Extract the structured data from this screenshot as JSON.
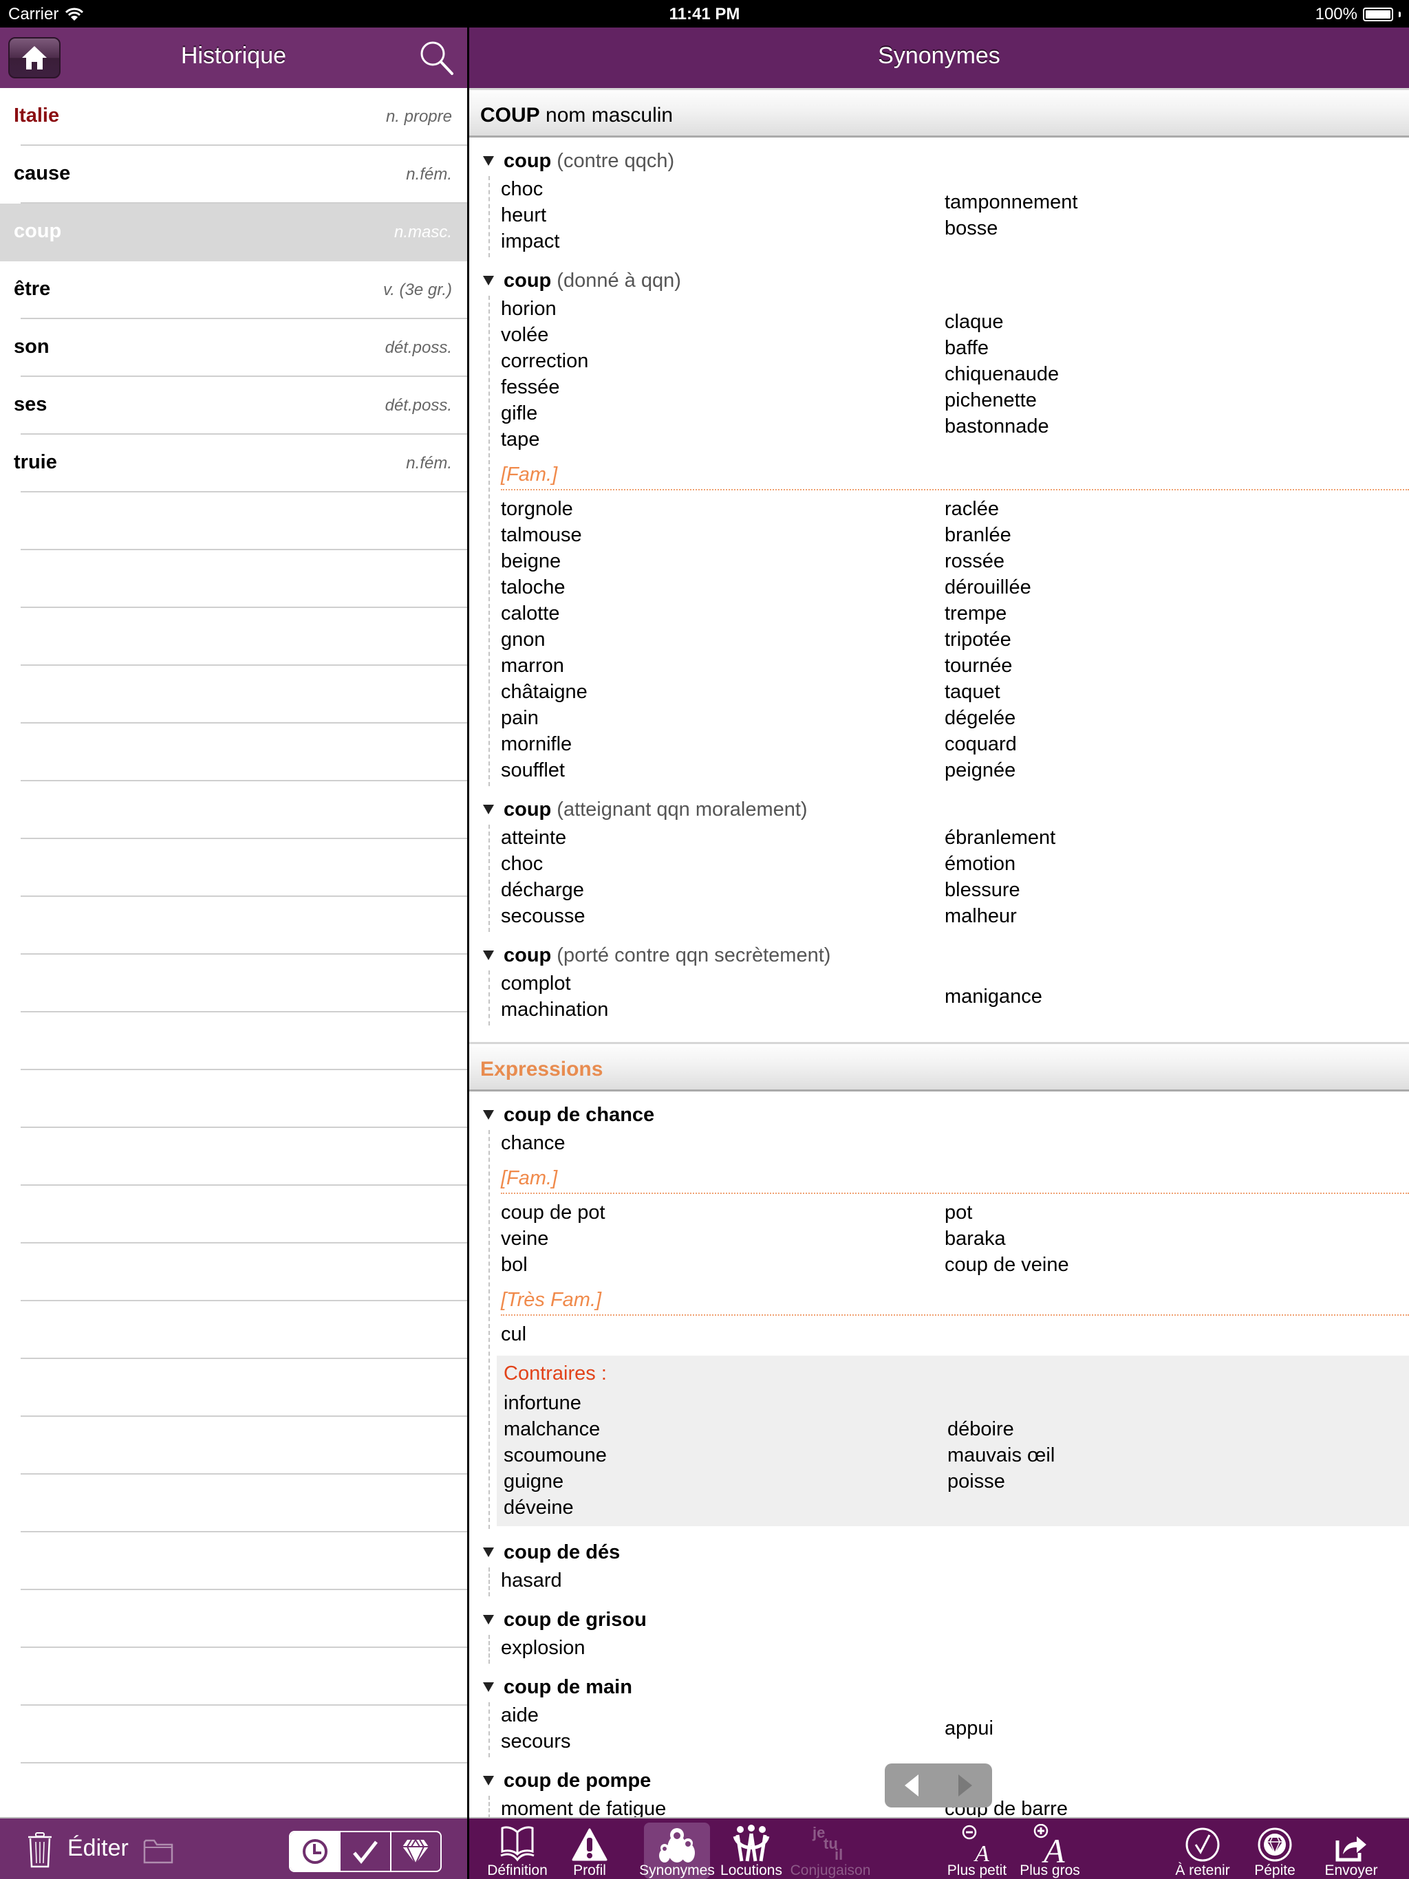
{
  "status_bar": {
    "carrier": "Carrier",
    "time": "11:41 PM",
    "battery": "100%"
  },
  "history": {
    "title": "Historique",
    "items": [
      {
        "word": "Italie",
        "category": "n. propre"
      },
      {
        "word": "cause",
        "category": "n.fém."
      },
      {
        "word": "coup",
        "category": "n.masc.",
        "selected": true
      },
      {
        "word": "être",
        "category": "v. (3e gr.)"
      },
      {
        "word": "son",
        "category": "dét.poss."
      },
      {
        "word": "ses",
        "category": "dét.poss."
      },
      {
        "word": "truie",
        "category": "n.fém."
      }
    ],
    "footer": {
      "edit_label": "Éditer"
    }
  },
  "synonyms": {
    "title": "Synonymes",
    "headword": "COUP",
    "headword_pos": "nom masculin",
    "senses": [
      {
        "word": "coup",
        "qualifier": "(contre qqch)",
        "groups": [
          {
            "left": [
              "choc",
              "heurt",
              "impact"
            ],
            "right": [
              "tamponnement",
              "bosse"
            ]
          }
        ]
      },
      {
        "word": "coup",
        "qualifier": "(donné à qqn)",
        "groups": [
          {
            "left": [
              "horion",
              "volée",
              "correction",
              "fessée",
              "gifle",
              "tape"
            ],
            "right": [
              "claque",
              "baffe",
              "chiquenaude",
              "pichenette",
              "bastonnade"
            ]
          },
          {
            "register": "[Fam.]",
            "left": [
              "torgnole",
              "talmouse",
              "beigne",
              "taloche",
              "calotte",
              "gnon",
              "marron",
              "châtaigne",
              "pain",
              "mornifle",
              "soufflet"
            ],
            "right": [
              "raclée",
              "branlée",
              "rossée",
              "dérouillée",
              "trempe",
              "tripotée",
              "tournée",
              "taquet",
              "dégelée",
              "coquard",
              "peignée"
            ]
          }
        ]
      },
      {
        "word": "coup",
        "qualifier": "(atteignant qqn moralement)",
        "groups": [
          {
            "left": [
              "atteinte",
              "choc",
              "décharge",
              "secousse"
            ],
            "right": [
              "ébranlement",
              "émotion",
              "blessure",
              "malheur"
            ]
          }
        ]
      },
      {
        "word": "coup",
        "qualifier": "(porté contre qqn secrètement)",
        "groups": [
          {
            "left": [
              "complot",
              "machination"
            ],
            "right": [
              "manigance"
            ]
          }
        ]
      }
    ],
    "expressions_label": "Expressions",
    "expressions": [
      {
        "word": "coup de chance",
        "groups": [
          {
            "left": [
              "chance"
            ],
            "right": []
          },
          {
            "register": "[Fam.]",
            "left": [
              "coup de pot",
              "veine",
              "bol"
            ],
            "right": [
              "pot",
              "baraka",
              "coup de veine"
            ]
          },
          {
            "register": "[Très Fam.]",
            "left": [
              "cul"
            ],
            "right": []
          }
        ],
        "contraires": {
          "label": "Contraires :",
          "left": [
            "infortune",
            "malchance",
            "scoumoune",
            "guigne",
            "déveine"
          ],
          "right": [
            "déboire",
            "mauvais œil",
            "poisse"
          ]
        }
      },
      {
        "word": "coup de dés",
        "groups": [
          {
            "left": [
              "hasard"
            ],
            "right": []
          }
        ]
      },
      {
        "word": "coup de grisou",
        "groups": [
          {
            "left": [
              "explosion"
            ],
            "right": []
          }
        ]
      },
      {
        "word": "coup de main",
        "groups": [
          {
            "left": [
              "aide",
              "secours"
            ],
            "right": [
              "appui"
            ]
          }
        ]
      },
      {
        "word": "coup de pompe",
        "groups": [
          {
            "left": [
              "moment de fatigue"
            ],
            "right": [
              "coup de barre"
            ]
          }
        ]
      }
    ]
  },
  "toolbar": {
    "items": [
      {
        "label": "Définition",
        "icon": "book-icon"
      },
      {
        "label": "Profil",
        "icon": "warning-icon"
      },
      {
        "label": "Synonymes",
        "icon": "dolls-icon",
        "active": true
      },
      {
        "label": "Locutions",
        "icon": "people-icon"
      },
      {
        "label": "Conjugaison",
        "icon": "je-tu-il-icon",
        "disabled": true
      },
      {
        "label": "Plus petit",
        "icon": "font-smaller-icon"
      },
      {
        "label": "Plus gros",
        "icon": "font-larger-icon"
      },
      {
        "label": "À retenir",
        "icon": "check-circle-icon"
      },
      {
        "label": "Pépite",
        "icon": "diamond-circle-icon"
      },
      {
        "label": "Envoyer",
        "icon": "share-icon"
      }
    ],
    "conj_glyphs": [
      "je",
      "tu",
      "il"
    ]
  },
  "colors": {
    "left_header": "#6f2f6d",
    "right_header": "#622362",
    "toolbar": "#5b1154",
    "accent_orange": "#f08a4b",
    "first_item_red": "#8b0e12",
    "contraires_red": "#e2431a"
  }
}
